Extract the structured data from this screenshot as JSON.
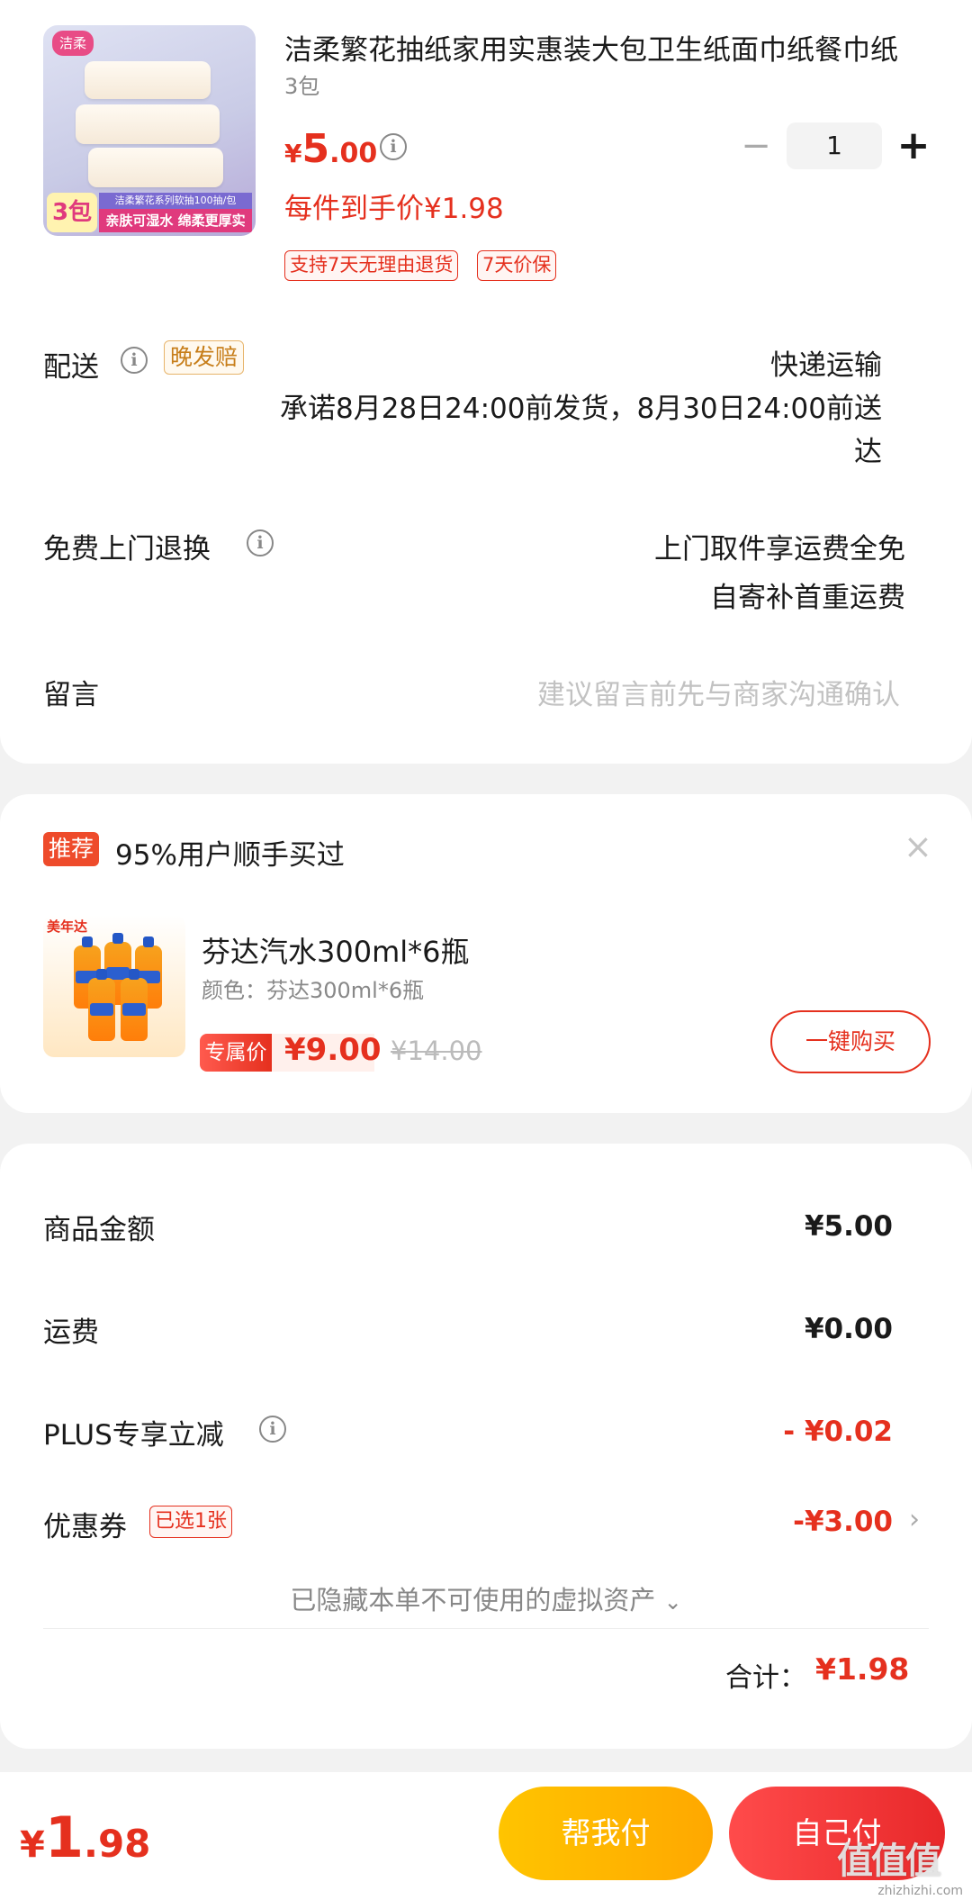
{
  "product": {
    "image_logo": "洁柔",
    "image_count": "3包",
    "image_strip_top": "洁柔繁花系列软抽100抽/包",
    "image_strip_bottom": "亲肤可湿水 绵柔更厚实",
    "title": "洁柔繁花抽纸家用实惠装大包卫生纸面巾纸餐巾纸",
    "variant": "3包",
    "price_symbol": "¥",
    "price_int": "5",
    "price_dec": ".00",
    "unit_price": "每件到手价¥1.98",
    "tags": [
      "支持7天无理由退货",
      "7天价保"
    ],
    "quantity": "1",
    "minus": "−",
    "plus": "+"
  },
  "delivery": {
    "label": "配送",
    "badge": "晚发赔",
    "method": "快递运输",
    "promise_line1": "承诺8月28日24:00前发货，8月30日24:00前送",
    "promise_line2": "达"
  },
  "returns": {
    "label": "免费上门退换",
    "line1": "上门取件享运费全免",
    "line2": "自寄补首重运费"
  },
  "message": {
    "label": "留言",
    "placeholder": "建议留言前先与商家沟通确认"
  },
  "recommend": {
    "badge": "推荐",
    "headline": "95%用户顺手买过",
    "close": "×",
    "image_brand": "美年达",
    "title": "芬达汽水300ml*6瓶",
    "sub": "颜色：芬达300ml*6瓶",
    "price_tag": "专属价",
    "price": "¥9.00",
    "original_price": "¥14.00",
    "buy_label": "一键购买"
  },
  "summary": {
    "goods_label": "商品金额",
    "goods_value": "¥5.00",
    "shipping_label": "运费",
    "shipping_value": "¥0.00",
    "plus_label": "PLUS专享立减",
    "plus_value": "- ¥0.02",
    "coupon_label": "优惠券",
    "coupon_badge": "已选1张",
    "coupon_value": "-¥3.00",
    "hidden_assets": "已隐藏本单不可使用的虚拟资产",
    "total_label": "合计：",
    "total_value": "¥1.98"
  },
  "bottom": {
    "price_symbol": "¥",
    "price_int": "1",
    "price_dec": ".98",
    "help_pay": "帮我付",
    "self_pay": "自己付"
  },
  "watermark": {
    "chars": "值值值",
    "site": "zhizhizhi.com"
  },
  "colors": {
    "accent_red": "#e5301e",
    "help_yellow": "#ffb800",
    "background": "#f2f2f2"
  }
}
